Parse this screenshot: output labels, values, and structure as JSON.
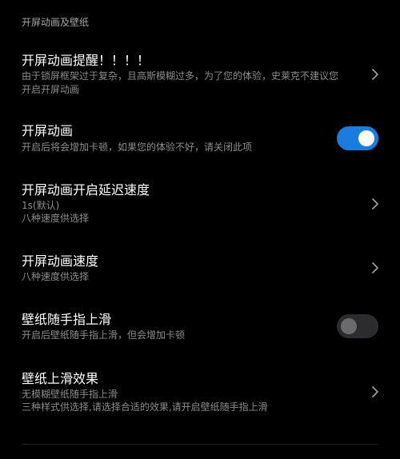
{
  "section": {
    "title": "开屏动画及壁纸"
  },
  "items": [
    {
      "title": "开屏动画提醒！！！！",
      "subtitle_lines": [
        "由于锁屏框架过于复杂，且高斯模糊过多，为了您的体验，史莱克不建议您",
        "开启开屏动画"
      ],
      "control": "chevron"
    },
    {
      "title": "开屏动画",
      "subtitle_lines": [
        "开启后将会增加卡顿，如果您的体验不好，请关闭此项"
      ],
      "control": "toggle",
      "enabled": true
    },
    {
      "title": "开屏动画开启延迟速度",
      "subtitle_lines": [
        "1s(默认)",
        "八种速度供选择"
      ],
      "control": "chevron"
    },
    {
      "title": "开屏动画速度",
      "subtitle_lines": [
        "八种速度供选择"
      ],
      "control": "chevron"
    },
    {
      "title": "壁纸随手指上滑",
      "subtitle_lines": [
        "开启后壁纸随手指上滑，但会增加卡顿"
      ],
      "control": "toggle",
      "enabled": false
    },
    {
      "title": "壁纸上滑效果",
      "subtitle_lines": [
        "无模糊壁纸随手指上滑",
        "三种样式供选择,请选择合适的效果,请开启壁纸随手指上滑"
      ],
      "control": "chevron"
    }
  ],
  "colors": {
    "background": "#000000",
    "toggle_on": "#1b7ce0",
    "toggle_off": "#2c2c2e",
    "subtitle": "#8c8c8c"
  },
  "icons": {
    "chevron": "chevron-right-icon"
  }
}
